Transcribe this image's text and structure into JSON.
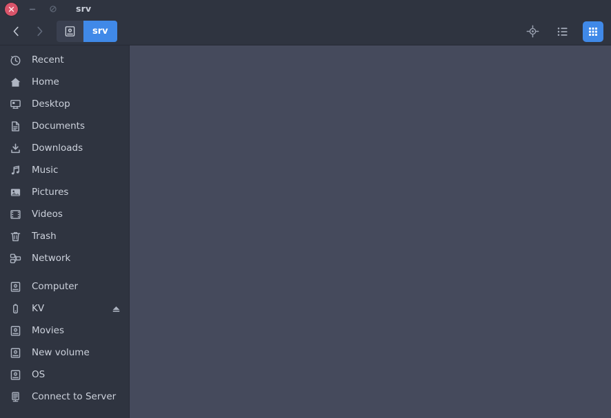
{
  "window": {
    "title": "srv",
    "controls": [
      {
        "name": "close",
        "label": "×"
      },
      {
        "name": "minimize",
        "label": "−"
      },
      {
        "name": "maximize",
        "label": "◯"
      }
    ]
  },
  "toolbar": {
    "back_label": "Back",
    "forward_label": "Forward",
    "back_icon": "chevron-left-icon",
    "forward_icon": "chevron-right-icon",
    "breadcrumbs": [
      {
        "label": "",
        "icon": "computer-icon",
        "active": false
      },
      {
        "label": "srv",
        "icon": "",
        "active": true
      }
    ],
    "actions": [
      {
        "name": "location-target-button",
        "icon": "location-target-icon",
        "label": "Location",
        "active": false
      },
      {
        "name": "list-view-button",
        "icon": "list-view-icon",
        "label": "List view",
        "active": false
      },
      {
        "name": "grid-view-button",
        "icon": "grid-view-icon",
        "label": "Grid view",
        "active": true
      }
    ]
  },
  "sidebar": {
    "groups": [
      {
        "items": [
          {
            "label": "Recent",
            "icon": "clock-icon",
            "eject": false
          },
          {
            "label": "Home",
            "icon": "home-icon",
            "eject": false
          },
          {
            "label": "Desktop",
            "icon": "desktop-icon",
            "eject": false
          },
          {
            "label": "Documents",
            "icon": "document-icon",
            "eject": false
          },
          {
            "label": "Downloads",
            "icon": "download-icon",
            "eject": false
          },
          {
            "label": "Music",
            "icon": "music-note-icon",
            "eject": false
          },
          {
            "label": "Pictures",
            "icon": "picture-icon",
            "eject": false
          },
          {
            "label": "Videos",
            "icon": "film-icon",
            "eject": false
          },
          {
            "label": "Trash",
            "icon": "trash-icon",
            "eject": false
          },
          {
            "label": "Network",
            "icon": "network-icon",
            "eject": false
          }
        ]
      },
      {
        "items": [
          {
            "label": "Computer",
            "icon": "computer-icon",
            "eject": false
          },
          {
            "label": "KV",
            "icon": "usb-drive-icon",
            "eject": true
          },
          {
            "label": "Movies",
            "icon": "drive-icon",
            "eject": false
          },
          {
            "label": "New volume",
            "icon": "drive-icon",
            "eject": false
          },
          {
            "label": "OS",
            "icon": "drive-icon",
            "eject": false
          },
          {
            "label": "Connect to Server",
            "icon": "server-icon",
            "eject": false
          }
        ]
      }
    ]
  },
  "content": {
    "files": [],
    "empty_text": ""
  },
  "colors": {
    "accent": "#4089e8",
    "titlebar_bg": "#2f3440",
    "sidebar_bg": "#2f3440",
    "content_bg": "#454a5c",
    "close_button": "#d9546a",
    "text": "#cdd2dc"
  }
}
